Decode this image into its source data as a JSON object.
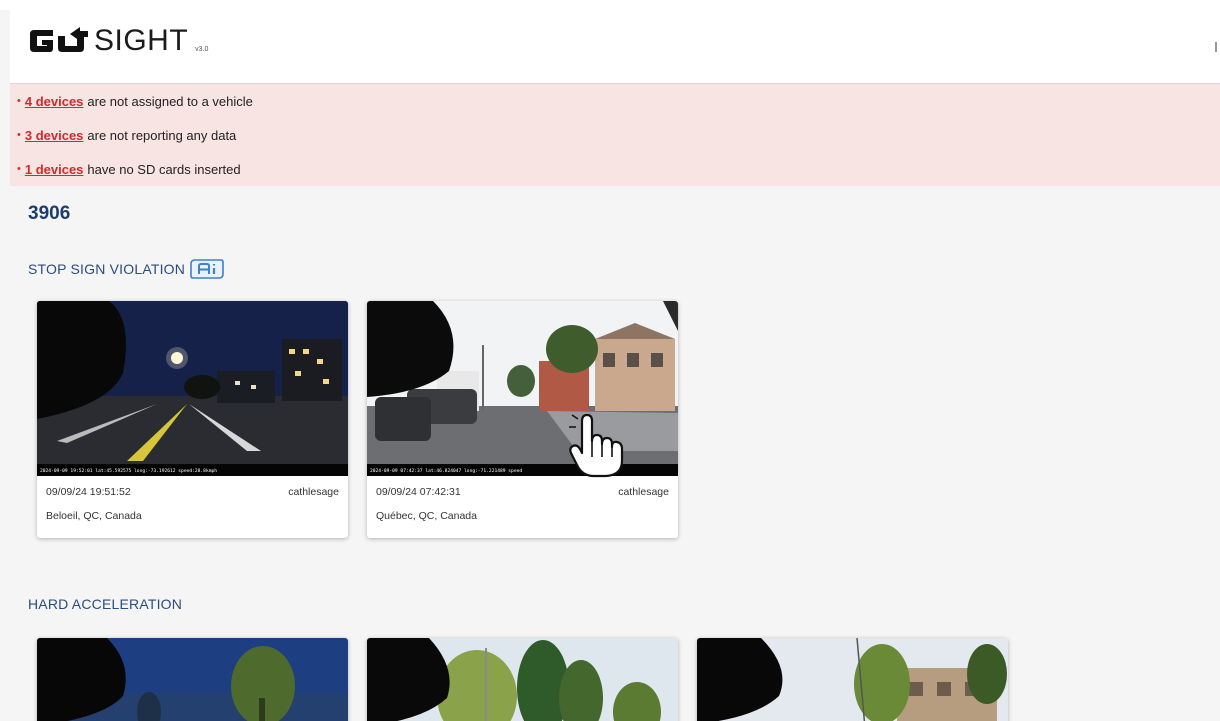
{
  "app": {
    "logo_text": "SIGHT",
    "version": "v3.0"
  },
  "alerts": [
    {
      "link": "4 devices",
      "text": "are not assigned to a vehicle"
    },
    {
      "link": "3 devices",
      "text": "are not reporting any data"
    },
    {
      "link": "1 devices",
      "text": "have no SD cards inserted"
    }
  ],
  "summary": {
    "count": "3906"
  },
  "sections": [
    {
      "title": "STOP SIGN VIOLATION",
      "ai_badge": "AI",
      "cards": [
        {
          "overlay": "2024-09-09 19:52:01 lat:45.592575 long:-73.192612 speed:28.8kmph",
          "date": "09/09/24 19:51:52",
          "user": "cathlesage",
          "location": "Beloeil, QC, Canada",
          "icon": "night-road-thumbnail"
        },
        {
          "overlay": "2024-09-09 07:42:37 lat:46.824047 long:-71.221489 speed",
          "date": "09/09/24 07:42:31",
          "user": "cathlesage",
          "location": "Québec, QC, Canada",
          "icon": "street-thumbnail"
        }
      ]
    },
    {
      "title": "HARD ACCELERATION",
      "cards": [
        {
          "icon": "night-trees-thumbnail"
        },
        {
          "icon": "day-trees-thumbnail"
        },
        {
          "icon": "day-building-thumbnail"
        }
      ]
    }
  ],
  "icons": {
    "cursor": "hand-pointer-icon",
    "logo": "go-logo-icon"
  },
  "colors": {
    "alert_bg": "#f8e4e2",
    "alert_link": "#d02a2a",
    "section_title": "#2b4c7e",
    "count": "#1f3c6e"
  }
}
